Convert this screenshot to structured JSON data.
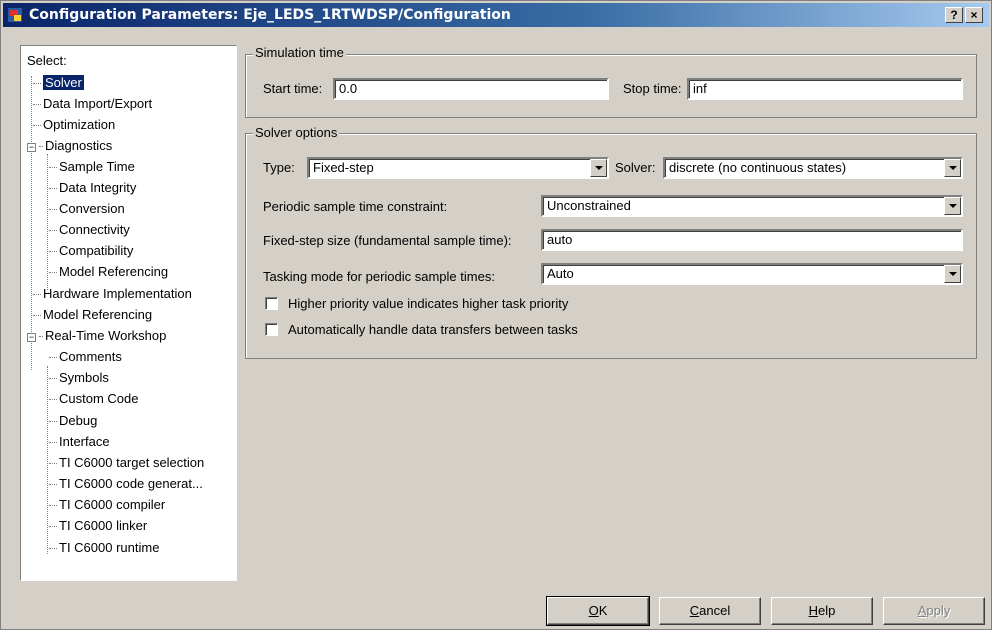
{
  "window": {
    "title": "Configuration Parameters: Eje_LEDS_1RTWDSP/Configuration",
    "help_glyph": "?",
    "close_glyph": "×"
  },
  "tree": {
    "header": "Select:",
    "items": [
      {
        "label": "Solver"
      },
      {
        "label": "Data Import/Export"
      },
      {
        "label": "Optimization"
      },
      {
        "label": "Diagnostics",
        "expander": "−"
      },
      {
        "label": "Sample Time"
      },
      {
        "label": "Data Integrity"
      },
      {
        "label": "Conversion"
      },
      {
        "label": "Connectivity"
      },
      {
        "label": "Compatibility"
      },
      {
        "label": "Model Referencing"
      },
      {
        "label": "Hardware Implementation"
      },
      {
        "label": "Model Referencing"
      },
      {
        "label": "Real-Time Workshop",
        "expander": "−"
      },
      {
        "label": "Comments"
      },
      {
        "label": "Symbols"
      },
      {
        "label": "Custom Code"
      },
      {
        "label": "Debug"
      },
      {
        "label": "Interface"
      },
      {
        "label": "TI C6000 target selection"
      },
      {
        "label": "TI C6000 code generat..."
      },
      {
        "label": "TI C6000 compiler"
      },
      {
        "label": "TI C6000 linker"
      },
      {
        "label": "TI C6000 runtime"
      }
    ],
    "selected": "Solver"
  },
  "simulation_time": {
    "legend": "Simulation time",
    "start_label": "Start time:",
    "start_value": "0.0",
    "stop_label": "Stop time:",
    "stop_value": "inf"
  },
  "solver_options": {
    "legend": "Solver options",
    "type_label": "Type:",
    "type_value": "Fixed-step",
    "solver_label": "Solver:",
    "solver_value": "discrete (no continuous states)",
    "periodic_label": "Periodic sample time constraint:",
    "periodic_value": "Unconstrained",
    "fixed_step_label": "Fixed-step size (fundamental sample time):",
    "fixed_step_value": "auto",
    "tasking_label": "Tasking mode for periodic sample times:",
    "tasking_value": "Auto",
    "check1_label": "Higher priority value indicates higher task priority",
    "check1_checked": false,
    "check2_label": "Automatically handle data transfers between tasks",
    "check2_checked": false
  },
  "buttons": {
    "ok": {
      "mnemonic": "O",
      "rest": "K"
    },
    "cancel": {
      "mnemonic": "C",
      "rest": "ancel"
    },
    "help": {
      "mnemonic": "H",
      "rest": "elp"
    },
    "apply": {
      "mnemonic": "A",
      "rest": "pply",
      "enabled": false
    }
  }
}
